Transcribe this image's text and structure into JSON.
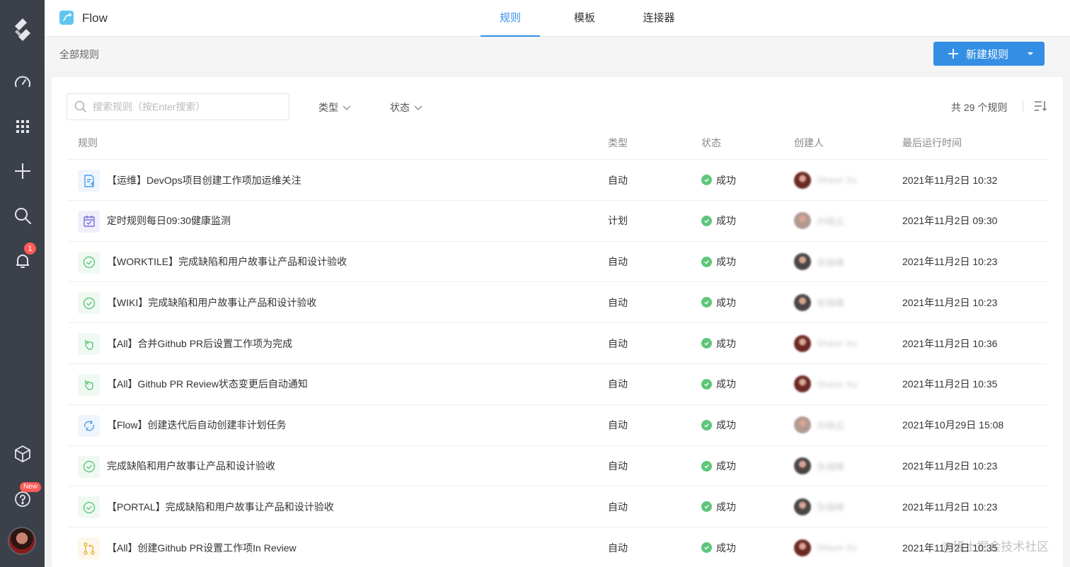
{
  "app": {
    "name": "Flow"
  },
  "tabs": [
    {
      "label": "规则",
      "active": true
    },
    {
      "label": "模板",
      "active": false
    },
    {
      "label": "连接器",
      "active": false
    }
  ],
  "sidebar": {
    "items": [
      "logo-icon",
      "dashboard-icon",
      "apps-grid-icon",
      "add-icon",
      "search-icon",
      "bell-icon",
      "cube-icon",
      "help-icon",
      "avatar"
    ],
    "notification_count": "1",
    "help_badge": "New"
  },
  "header": {
    "breadcrumb": "全部规则",
    "new_button": "新建规则"
  },
  "toolbar": {
    "search_placeholder": "搜索规则（按Enter搜索）",
    "filter_type": "类型",
    "filter_status": "状态",
    "count_text": "共 29 个规则"
  },
  "table": {
    "columns": [
      "规则",
      "类型",
      "状态",
      "创建人",
      "最后运行时间"
    ],
    "rows": [
      {
        "name": "【运维】DevOps项目创建工作项加运维关注",
        "icon": "form-icon",
        "icon_color": "#4a9ee8",
        "icon_bg": "#eef5fc",
        "type": "自动",
        "status": "成功",
        "creator": "Shaun Xu",
        "avatar": "#6b2a25",
        "time": "2021年11月2日 10:32"
      },
      {
        "name": "定时规则每日09:30健康监测",
        "icon": "calendar-check-icon",
        "icon_color": "#7b70d6",
        "icon_bg": "#f1effb",
        "type": "计划",
        "status": "成功",
        "creator": "孙晓云",
        "avatar": "#b09a92",
        "time": "2021年11月2日 09:30"
      },
      {
        "name": "【WORKTILE】完成缺陷和用户故事让产品和设计验收",
        "icon": "check-circle-icon",
        "icon_color": "#5ec67a",
        "icon_bg": "#eff9f2",
        "type": "自动",
        "status": "成功",
        "creator": "张瑞峰",
        "avatar": "#4b4646",
        "time": "2021年11月2日 10:23"
      },
      {
        "name": "【WIKI】完成缺陷和用户故事让产品和设计验收",
        "icon": "check-circle-icon",
        "icon_color": "#5ec67a",
        "icon_bg": "#eff9f2",
        "type": "自动",
        "status": "成功",
        "creator": "张瑞峰",
        "avatar": "#4b4646",
        "time": "2021年11月2日 10:23"
      },
      {
        "name": "【All】合并Github PR后设置工作项为完成",
        "icon": "hand-icon",
        "icon_color": "#5ec67a",
        "icon_bg": "#eff9f2",
        "type": "自动",
        "status": "成功",
        "creator": "Shaun Xu",
        "avatar": "#6b2a25",
        "time": "2021年11月2日 10:36"
      },
      {
        "name": "【All】Github PR Review状态变更后自动通知",
        "icon": "hand-icon",
        "icon_color": "#5ec67a",
        "icon_bg": "#eff9f2",
        "type": "自动",
        "status": "成功",
        "creator": "Shaun Xu",
        "avatar": "#6b2a25",
        "time": "2021年11月2日 10:35"
      },
      {
        "name": "【Flow】创建迭代后自动创建非计划任务",
        "icon": "cycle-icon",
        "icon_color": "#4a9ee8",
        "icon_bg": "#eef5fc",
        "type": "自动",
        "status": "成功",
        "creator": "孙晓云",
        "avatar": "#b09a92",
        "time": "2021年10月29日 15:08"
      },
      {
        "name": " 完成缺陷和用户故事让产品和设计验收",
        "icon": "check-circle-icon",
        "icon_color": "#5ec67a",
        "icon_bg": "#eff9f2",
        "type": "自动",
        "status": "成功",
        "creator": "张瑞峰",
        "avatar": "#4b4646",
        "time": "2021年11月2日 10:23"
      },
      {
        "name": "【PORTAL】完成缺陷和用户故事让产品和设计验收",
        "icon": "check-circle-icon",
        "icon_color": "#5ec67a",
        "icon_bg": "#eff9f2",
        "type": "自动",
        "status": "成功",
        "creator": "张瑞峰",
        "avatar": "#4b4646",
        "time": "2021年11月2日 10:23"
      },
      {
        "name": "【All】创建Github PR设置工作项In Review",
        "icon": "git-pr-icon",
        "icon_color": "#e8b23a",
        "icon_bg": "#fdf7ea",
        "type": "自动",
        "status": "成功",
        "creator": "Shaun Xu",
        "avatar": "#6b2a25",
        "time": "2021年11月2日 10:35"
      }
    ]
  },
  "watermark": "@稀土掘金技术社区",
  "colors": {
    "accent": "#348fe4",
    "sidebar": "#3c4049",
    "success": "#5ec67a",
    "badge": "#ff5b57"
  }
}
